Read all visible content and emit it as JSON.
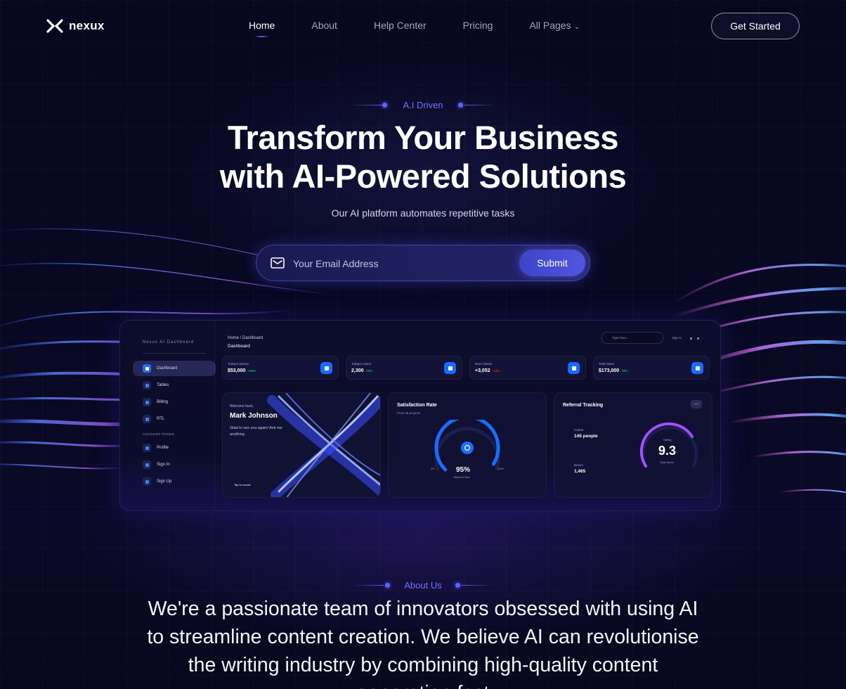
{
  "brand": {
    "name": "nexux"
  },
  "nav": {
    "links": [
      {
        "label": "Home"
      },
      {
        "label": "About"
      },
      {
        "label": "Help Center"
      },
      {
        "label": "Pricing"
      },
      {
        "label": "All Pages"
      }
    ],
    "cta": "Get Started"
  },
  "hero": {
    "eyebrow": "A.I Driven",
    "title_line1": "Transform Your Business",
    "title_line2": "with AI-Powered Solutions",
    "subtitle": "Our AI platform automates repetitive tasks",
    "email_placeholder": "Your Email Address",
    "submit_label": "Submit"
  },
  "dashboard": {
    "brand": "Nexux AI Dashboard",
    "sidebar": [
      {
        "label": "Dashboard",
        "active": true
      },
      {
        "label": "Tables"
      },
      {
        "label": "Billing"
      },
      {
        "label": "RTL"
      }
    ],
    "account_section": "ACCOUNT PAGES",
    "account_items": [
      {
        "label": "Profile"
      },
      {
        "label": "Sign In"
      },
      {
        "label": "Sign Up"
      }
    ],
    "breadcrumb": "Home  /  Dashboard",
    "page_title": "Dashboard",
    "search_placeholder": "Type here...",
    "signin": "Sign In",
    "stats": [
      {
        "label": "Today's Money",
        "value": "$53,000",
        "change": "+55%",
        "change_color": "#01b574"
      },
      {
        "label": "Today's Users",
        "value": "2,300",
        "change": "+5%",
        "change_color": "#01b574"
      },
      {
        "label": "New Clients",
        "value": "+3,052",
        "change": "-14%",
        "change_color": "#e31a1a"
      },
      {
        "label": "Total Sales",
        "value": "$173,000",
        "change": "+8%",
        "change_color": "#01b574"
      }
    ],
    "welcome": {
      "greeting": "Welcome back,",
      "name": "Mark Johnson",
      "message": "Glad to see you again! Ask me anything.",
      "tap": "Tap to record"
    },
    "satisfaction": {
      "title": "Satisfaction Rate",
      "subtitle": "From all projects",
      "value": "95%",
      "value_sub": "Based on likes",
      "min": "0%",
      "max": "100%",
      "fraction": 0.95
    },
    "referral": {
      "title": "Referral Tracking",
      "invited_label": "Invited",
      "invited_value": "145 people",
      "bonus_label": "Bonus",
      "bonus_value": "1,465",
      "safety_label": "Safety",
      "score": "9.3",
      "score_label": "Total Score",
      "menu": "..."
    }
  },
  "about": {
    "eyebrow": "About Us",
    "text": "We're a passionate team of innovators obsessed with using AI to streamline content creation. We believe AI can revolutionise the writing industry by combining high-quality content generation fast"
  },
  "colors": {
    "background": "#06061a",
    "accent": "#5a62ff",
    "stat_icon": "#1a6cff"
  }
}
